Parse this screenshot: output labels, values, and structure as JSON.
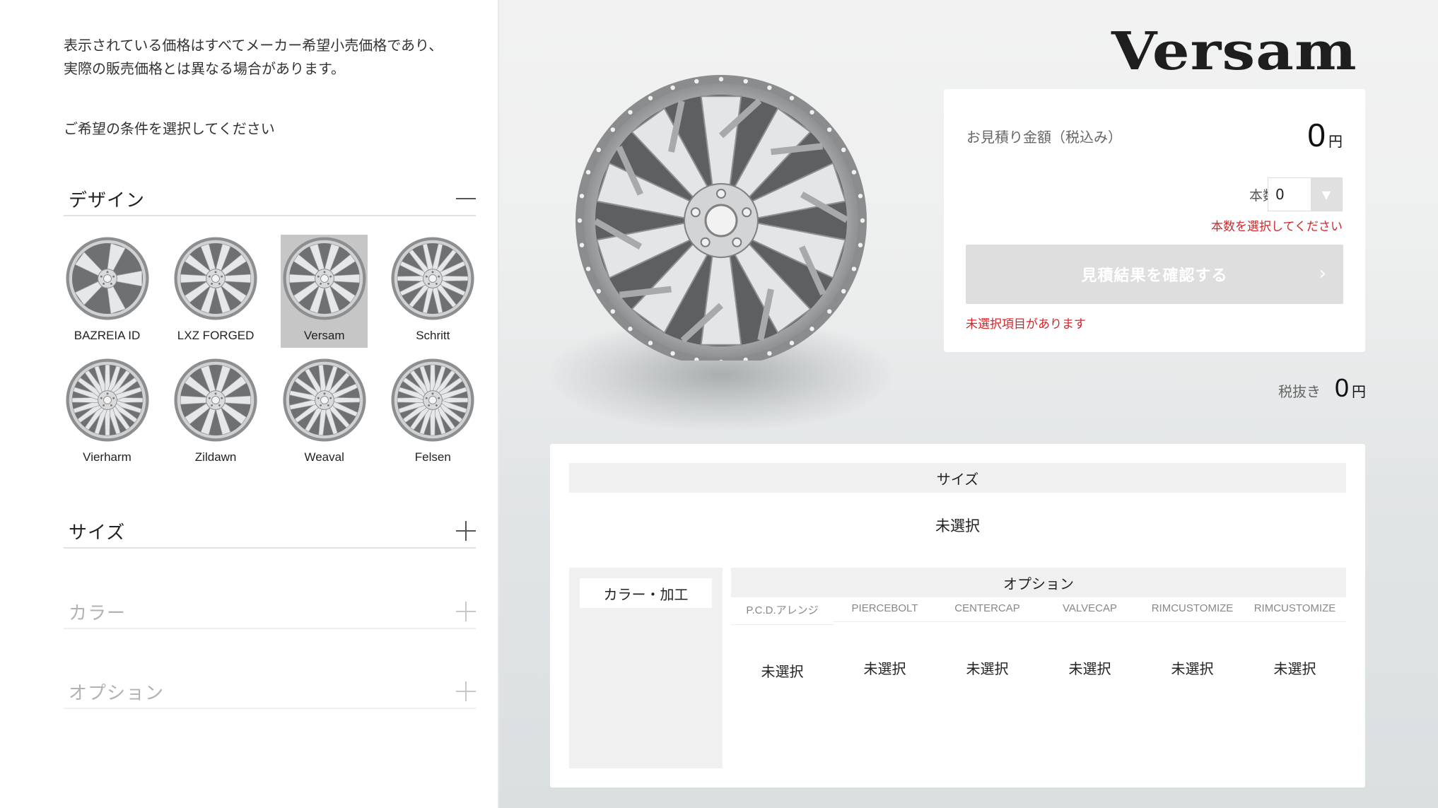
{
  "left": {
    "notice_line1": "表示されている価格はすべてメーカー希望小売価格であり、",
    "notice_line2": "実際の販売価格とは異なる場合があります。",
    "prompt": "ご希望の条件を選択してください",
    "sections": {
      "design": "デザイン",
      "size": "サイズ",
      "color": "カラー",
      "option": "オプション"
    },
    "designs": [
      {
        "name": "BAZREIA ID",
        "selected": false
      },
      {
        "name": "LXZ FORGED",
        "selected": false
      },
      {
        "name": "Versam",
        "selected": true
      },
      {
        "name": "Schritt",
        "selected": false
      },
      {
        "name": "Vierharm",
        "selected": false
      },
      {
        "name": "Zildawn",
        "selected": false
      },
      {
        "name": "Weaval",
        "selected": false
      },
      {
        "name": "Felsen",
        "selected": false
      }
    ]
  },
  "brand": {
    "logo": "Versam"
  },
  "quote": {
    "label": "お見積り金額（税込み）",
    "amount": "0",
    "unit": "円",
    "qty_label": "本数",
    "qty_value": "0",
    "qty_error": "本数を選択してください",
    "confirm_button": "見積結果を確認する",
    "warning": "未選択項目があります"
  },
  "tax_excluded": {
    "label": "税抜き",
    "amount": "0",
    "unit": "円"
  },
  "summary": {
    "size_header": "サイズ",
    "size_value": "未選択",
    "color_header": "カラー・加工",
    "option_header": "オプション",
    "option_columns": [
      {
        "header": "P.C.D.アレンジ",
        "value": "未選択"
      },
      {
        "header": "PIERCEBOLT",
        "value": "未選択"
      },
      {
        "header": "CENTERCAP",
        "value": "未選択"
      },
      {
        "header": "VALVECAP",
        "value": "未選択"
      },
      {
        "header": "RIMCUSTOMIZE",
        "value": "未選択"
      },
      {
        "header": "RIMCUSTOMIZE",
        "value": "未選択"
      }
    ]
  },
  "colors": {
    "error": "#d3262a",
    "selected_bg": "#c6c6c6",
    "button_disabled": "#dedede"
  }
}
